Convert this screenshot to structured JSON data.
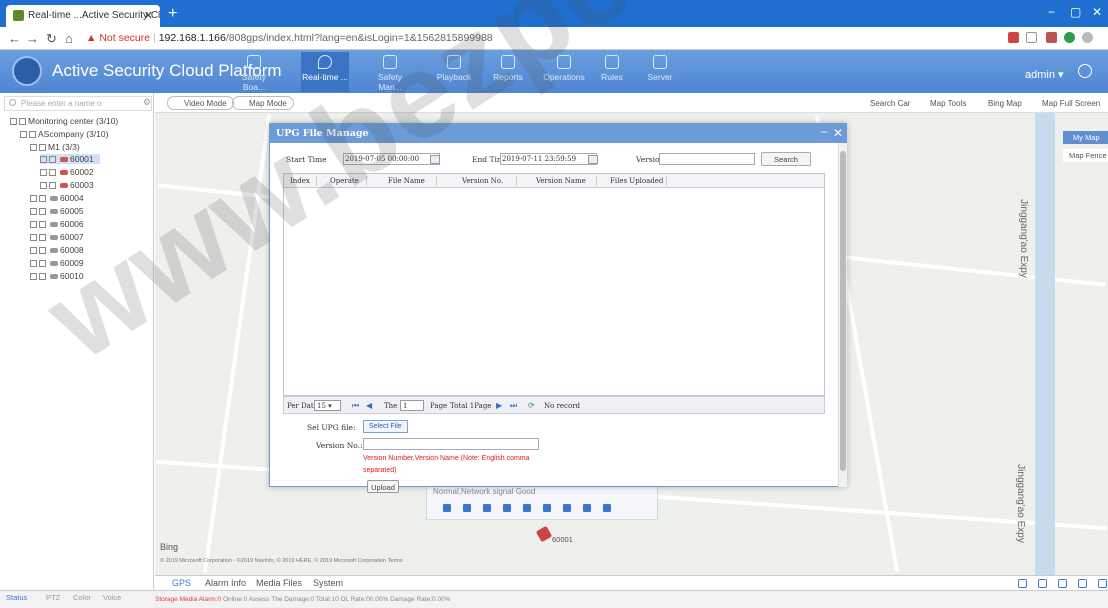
{
  "browser": {
    "tab_title": "Real-time ...Active Security Cl",
    "url_warning": "Not secure",
    "url_host": "192.168.1.166",
    "url_path": "/808gps/index.html?lang=en&isLogin=1&1562815899988"
  },
  "app": {
    "title": "Active Security Cloud Platform",
    "nav": [
      {
        "label": "Safety Boa..."
      },
      {
        "label": "Real-time ..."
      },
      {
        "label": "Safety Man..."
      },
      {
        "label": "Playback"
      },
      {
        "label": "Reports"
      },
      {
        "label": "Operations"
      },
      {
        "label": "Rules"
      },
      {
        "label": "Server"
      }
    ],
    "user": "admin"
  },
  "left": {
    "search_placeholder": "Please enter a name o",
    "tree": [
      {
        "label": "Monitoring center (3/10)"
      },
      {
        "label": "AScompany (3/10)"
      },
      {
        "label": "M1 (3/3)"
      },
      {
        "label": "60001"
      },
      {
        "label": "60002"
      },
      {
        "label": "60003"
      },
      {
        "label": "60004"
      },
      {
        "label": "60005"
      },
      {
        "label": "60006"
      },
      {
        "label": "60007"
      },
      {
        "label": "60008"
      },
      {
        "label": "60009"
      },
      {
        "label": "60010"
      }
    ],
    "bottom_tabs": [
      "Status",
      "PTZ",
      "Color",
      "Voice"
    ]
  },
  "map": {
    "video_mode": "Video Mode",
    "map_mode": "Map Mode",
    "tools": [
      "Search Car",
      "Map Tools",
      "Bing Map",
      "Map Full Screen"
    ],
    "my_map": "My Map",
    "map_fence": "Map Fence",
    "expressway": "Jinggang'ao Expy",
    "vehicle_label": "60001",
    "popup_status": "Normal,Network signal Good",
    "bing": "Bing",
    "copyright": "© 2019 Microsoft Corporation - ©2019 NavInfo, © 2019 HERE, © 2019 Microsoft Corporation  Terms"
  },
  "bottom": {
    "tabs": [
      "GPS",
      "Alarm Info",
      "Media Files",
      "System"
    ],
    "status_alarm": "Storage Media Alarm:0",
    "status_rest": "Online:0  Assess The Damage:0  Total:10  OL Rate:00.00%  Damage Rate:0.00%"
  },
  "dialog": {
    "title": "UPG File Manage",
    "start_label": "Start Time",
    "start_value": "2019-07-05 00:00:00",
    "end_label": "End Time",
    "end_value": "2019-07-11 23:59:59",
    "version_label": "Version",
    "version_value": "",
    "search": "Search",
    "columns": [
      "Index",
      "Operate",
      "File Name",
      "Version No.",
      "Version Name",
      "Files Uploaded"
    ],
    "pager": {
      "per_data_label": "Per Data",
      "per_data_value": "15",
      "the_label": "The",
      "page_value": "1",
      "page_label": "Page",
      "total": "Total 1Page",
      "no_record": "No record"
    },
    "sel_file_label": "Sel UPG file:",
    "select_file": "Select File",
    "version_no_label": "Version No.:",
    "note": "Version Number,Version Name (Note: English comma separated)",
    "upload": "Upload"
  },
  "watermark": "www.bezpeke"
}
